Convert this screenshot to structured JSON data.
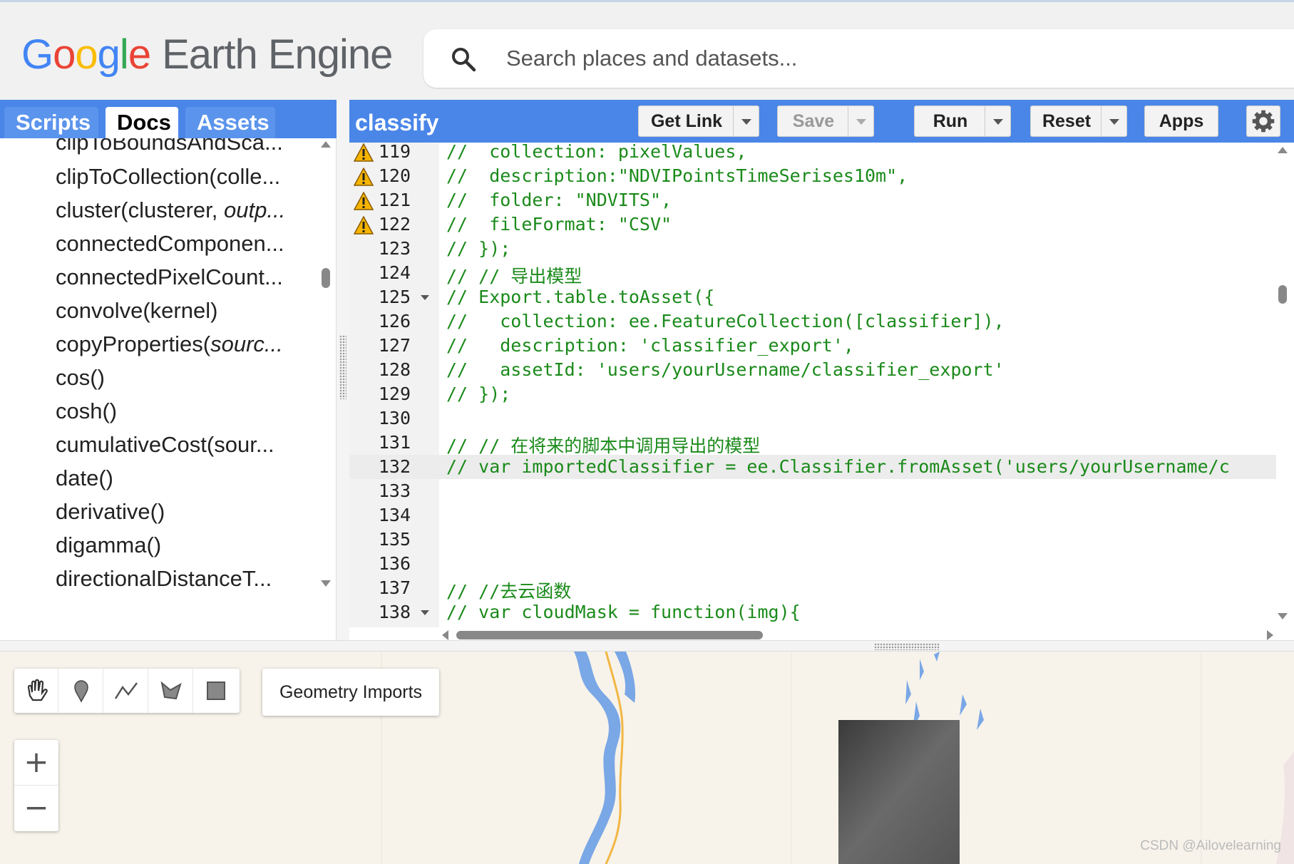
{
  "app": {
    "logo_google": [
      "G",
      "o",
      "o",
      "g",
      "l",
      "e"
    ],
    "logo_product": "Earth Engine"
  },
  "search": {
    "placeholder": "Search places and datasets..."
  },
  "left_panel": {
    "tabs": [
      {
        "label": "Scripts",
        "active": false
      },
      {
        "label": "Docs",
        "active": true
      },
      {
        "label": "Assets",
        "active": false
      }
    ],
    "doc_items": [
      "clipToBoundsAndSca...",
      "clipToCollection(colle...",
      "cluster(clusterer, outp...",
      "connectedComponen...",
      "connectedPixelCount...",
      "convolve(kernel)",
      "copyProperties(sourc...",
      "cos()",
      "cosh()",
      "cumulativeCost(sour...",
      "date()",
      "derivative()",
      "digamma()",
      "directionalDistanceT..."
    ]
  },
  "editor": {
    "script_name": "classify",
    "buttons": {
      "get_link": "Get Link",
      "save": "Save",
      "run": "Run",
      "reset": "Reset",
      "apps": "Apps"
    },
    "lines": [
      {
        "num": "119",
        "code": "//  collection: pixelValues,",
        "warn": true,
        "fold": false,
        "highlight": false
      },
      {
        "num": "120",
        "code": "//  description:\"NDVIPointsTimeSerises10m\",",
        "warn": true,
        "fold": false,
        "highlight": false
      },
      {
        "num": "121",
        "code": "//  folder: \"NDVITS\",",
        "warn": true,
        "fold": false,
        "highlight": false
      },
      {
        "num": "122",
        "code": "//  fileFormat: \"CSV\"",
        "warn": true,
        "fold": false,
        "highlight": false
      },
      {
        "num": "123",
        "code": "// });",
        "warn": false,
        "fold": false,
        "highlight": false
      },
      {
        "num": "124",
        "code": "// // 导出模型",
        "warn": false,
        "fold": false,
        "highlight": false
      },
      {
        "num": "125",
        "code": "// Export.table.toAsset({",
        "warn": false,
        "fold": true,
        "highlight": false
      },
      {
        "num": "126",
        "code": "//   collection: ee.FeatureCollection([classifier]),",
        "warn": false,
        "fold": false,
        "highlight": false
      },
      {
        "num": "127",
        "code": "//   description: 'classifier_export',",
        "warn": false,
        "fold": false,
        "highlight": false
      },
      {
        "num": "128",
        "code": "//   assetId: 'users/yourUsername/classifier_export'",
        "warn": false,
        "fold": false,
        "highlight": false
      },
      {
        "num": "129",
        "code": "// });",
        "warn": false,
        "fold": false,
        "highlight": false
      },
      {
        "num": "130",
        "code": "",
        "warn": false,
        "fold": false,
        "highlight": false
      },
      {
        "num": "131",
        "code": "// // 在将来的脚本中调用导出的模型",
        "warn": false,
        "fold": false,
        "highlight": false
      },
      {
        "num": "132",
        "code": "// var importedClassifier = ee.Classifier.fromAsset('users/yourUsername/c",
        "warn": false,
        "fold": false,
        "highlight": true
      },
      {
        "num": "133",
        "code": "",
        "warn": false,
        "fold": false,
        "highlight": false
      },
      {
        "num": "134",
        "code": "",
        "warn": false,
        "fold": false,
        "highlight": false
      },
      {
        "num": "135",
        "code": "",
        "warn": false,
        "fold": false,
        "highlight": false
      },
      {
        "num": "136",
        "code": "",
        "warn": false,
        "fold": false,
        "highlight": false
      },
      {
        "num": "137",
        "code": "// //去云函数",
        "warn": false,
        "fold": false,
        "highlight": false
      },
      {
        "num": "138",
        "code": "// var cloudMask = function(img){",
        "warn": false,
        "fold": true,
        "highlight": false
      }
    ]
  },
  "map": {
    "geometry_imports_label": "Geometry Imports",
    "zoom_in": "+",
    "zoom_out": "−",
    "tools": [
      "hand-icon",
      "marker-icon",
      "line-icon",
      "polygon-icon",
      "rectangle-icon"
    ],
    "watermark": "CSDN @Ailovelearning"
  },
  "colors": {
    "toolbar_blue": "#4a86e8",
    "code_comment_green": "#1a8a1a",
    "river_blue": "#7aa7e6",
    "road_orange": "#f2b644"
  }
}
